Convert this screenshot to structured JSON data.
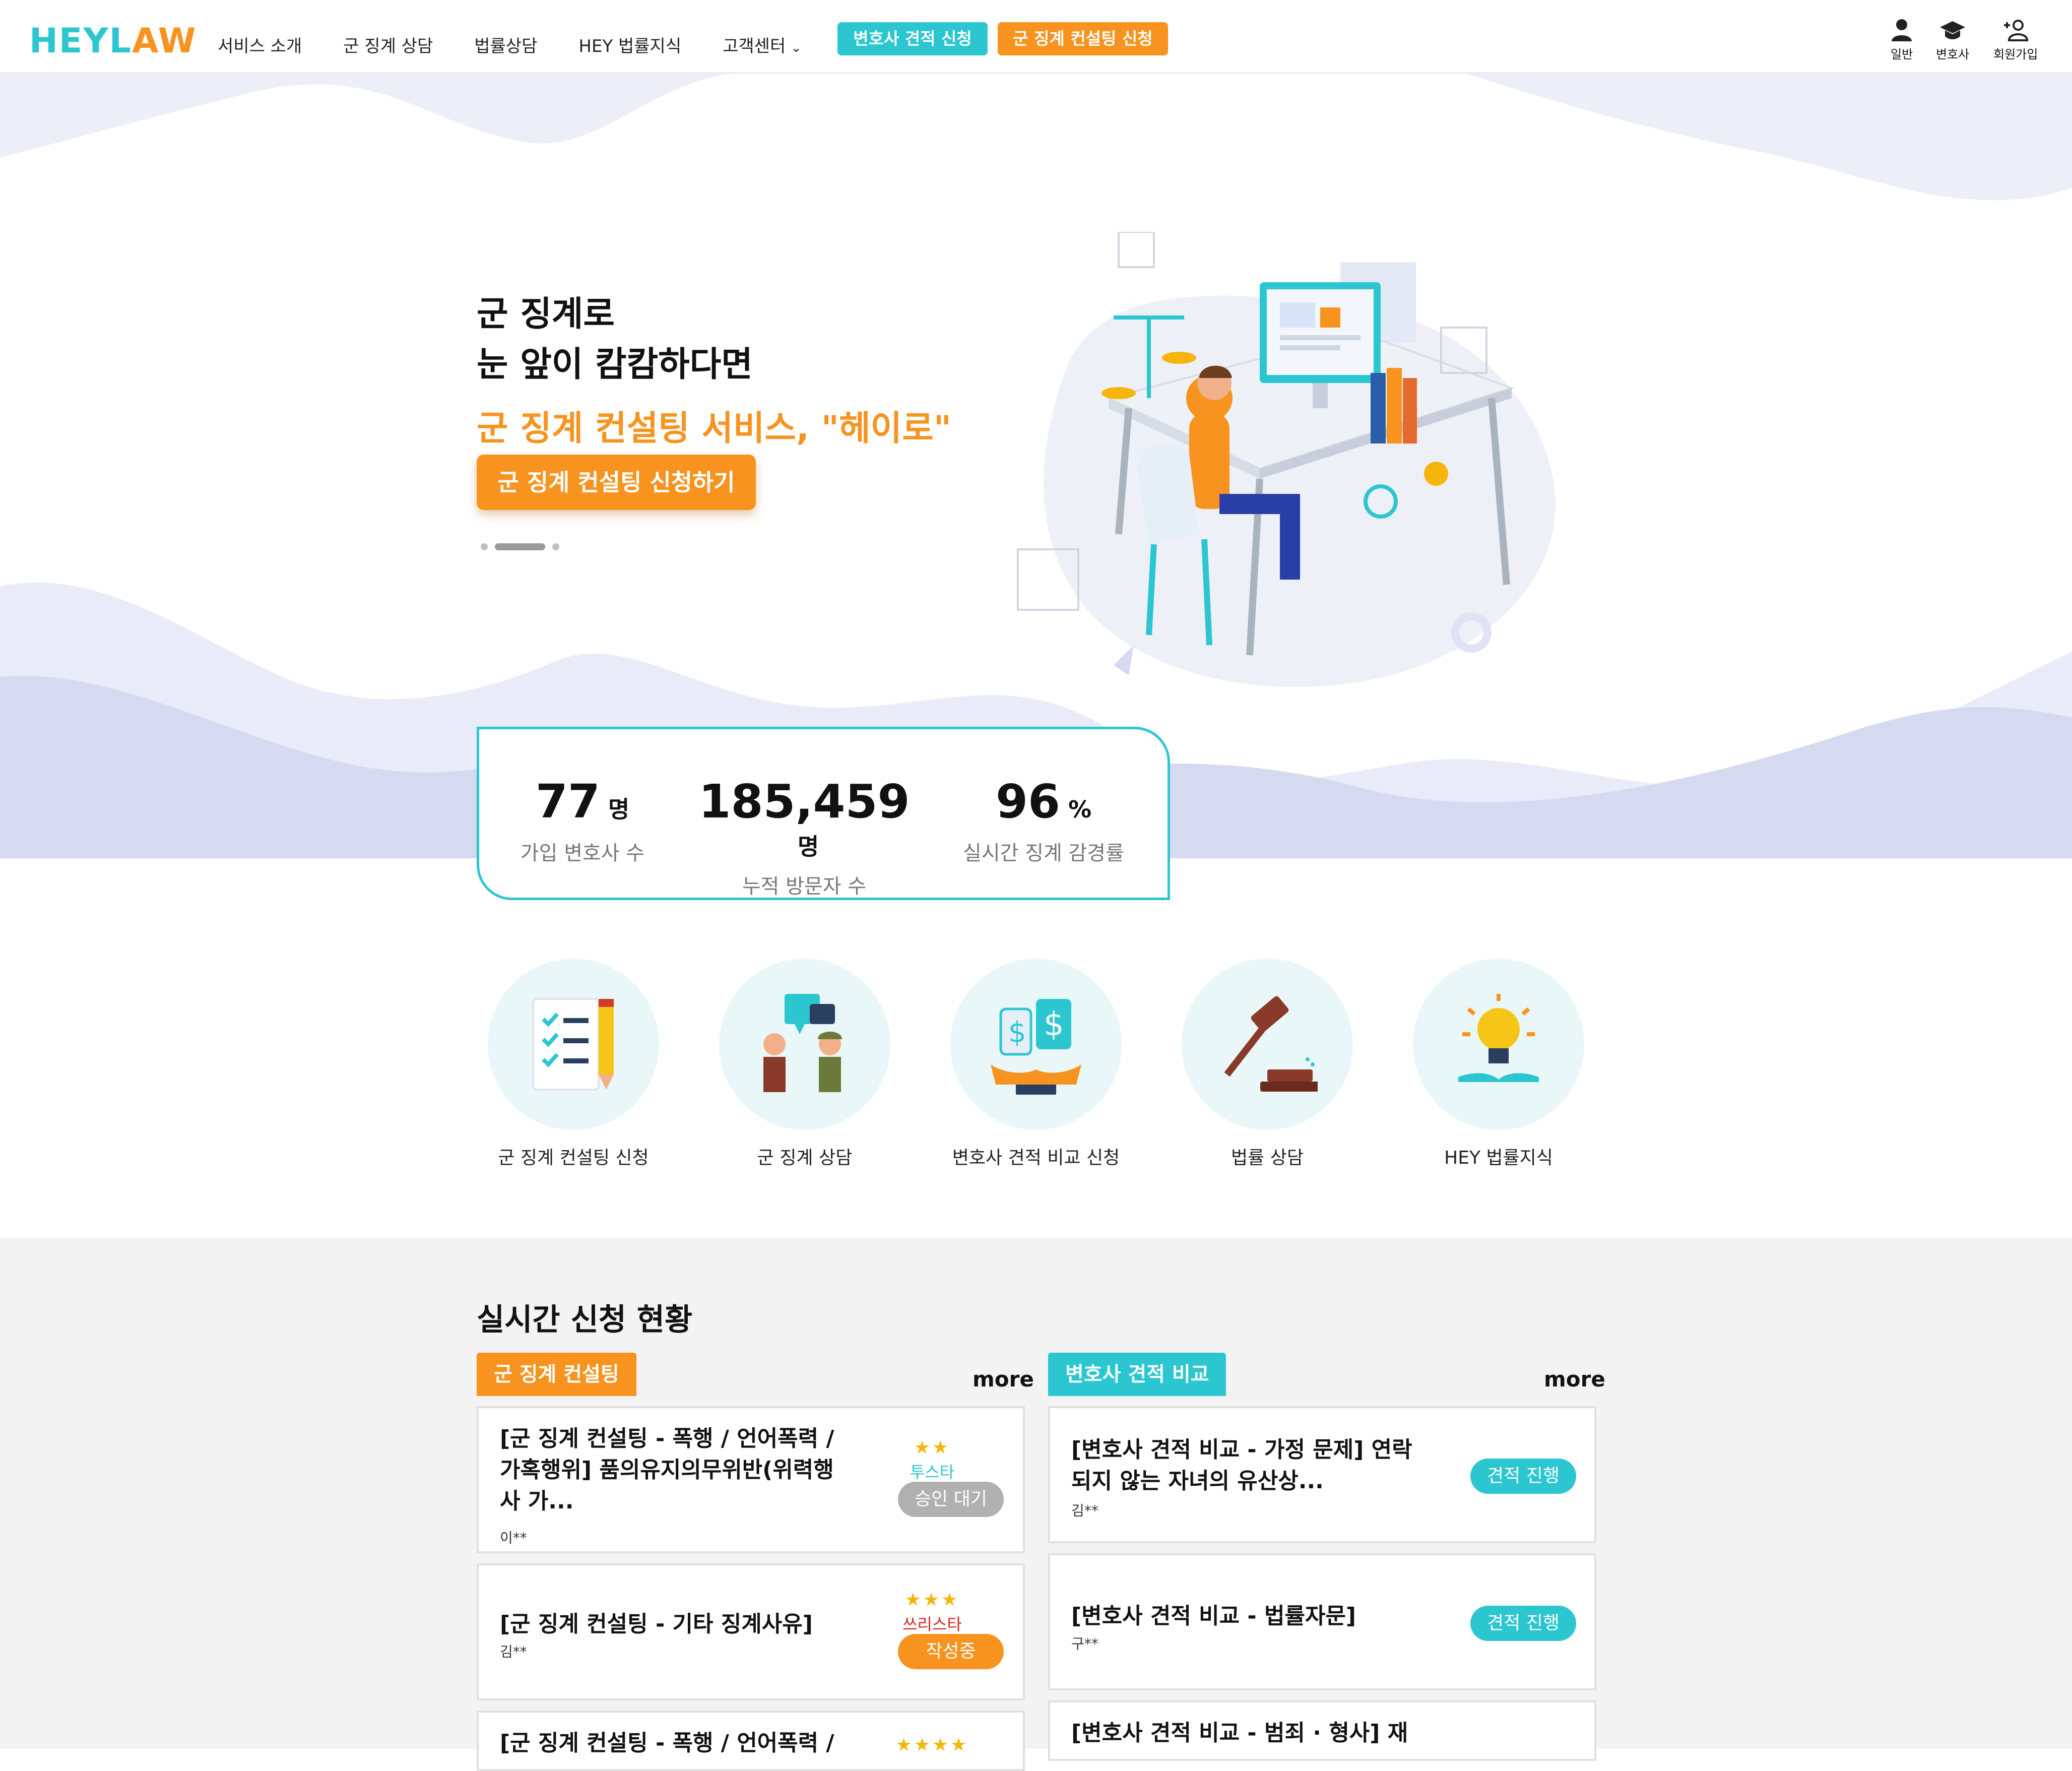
{
  "header": {
    "logo_a": "HEY",
    "logo_b": "L",
    "logo_c": "AW",
    "nav": [
      "서비스 소개",
      "군 징계 상담",
      "법률상담",
      "HEY 법률지식",
      "고객센터"
    ],
    "btn_lawyer_quote": "변호사 견적 신청",
    "btn_consulting": "군 징계 컨설팅 신청",
    "user_links": [
      "일반",
      "변호사",
      "회원가입"
    ]
  },
  "hero": {
    "title_line1": "군 징계로",
    "title_line2": "눈 앞이 캄캄하다면",
    "subtitle": "군 징계 컨설팅 서비스, \"헤이로\"",
    "cta": "군 징계 컨설팅 신청하기",
    "slides_total": 3,
    "slide_active": 2
  },
  "stats": [
    {
      "value": "77",
      "unit": "명",
      "label": "가입 변호사 수"
    },
    {
      "value": "185,459",
      "unit": "명",
      "label": "누적 방문자 수"
    },
    {
      "value": "96",
      "unit": "%",
      "label": "실시간 징계 감경률"
    }
  ],
  "services": [
    {
      "label": "군 징계 컨설팅 신청",
      "icon": "checklist-icon"
    },
    {
      "label": "군 징계 상담",
      "icon": "consultation-icon"
    },
    {
      "label": "변호사 견적 비교 신청",
      "icon": "price-tag-icon"
    },
    {
      "label": "법률 상담",
      "icon": "gavel-icon"
    },
    {
      "label": "HEY 법률지식",
      "icon": "lightbulb-icon"
    }
  ],
  "live": {
    "title": "실시간 신청 현황",
    "left_tag": "군 징계 컨설팅",
    "right_tag": "변호사 견적 비교",
    "more": "more",
    "left_cards": [
      {
        "title1": "[군 징계 컨설팅 - 폭행 / 언어폭력 /",
        "title2": "가혹행위] 품의유지의무위반(위력행",
        "title3": "사 가...",
        "name": "이**",
        "stars": "★★",
        "grade": "투스타",
        "status": "승인 대기"
      },
      {
        "title1": "[군 징계 컨설팅 - 기타 징계사유]",
        "name": "김**",
        "stars": "★★★",
        "grade": "쓰리스타",
        "status": "작성중"
      },
      {
        "title1": "[군 징계 컨설팅 - 폭행 / 언어폭력 /",
        "stars": "★★★★"
      }
    ],
    "right_cards": [
      {
        "title1": "[변호사 견적 비교 - 가정 문제] 연락",
        "title2": "되지 않는 자녀의 유산상...",
        "name": "김**",
        "status": "견적 진행"
      },
      {
        "title1": "[변호사 견적 비교 - 법률자문]",
        "name": "구**",
        "status": "견적 진행"
      },
      {
        "title1": "[변호사 견적 비교 - 범죄 · 형사] 재"
      }
    ]
  },
  "colors": {
    "teal": "#2cc6d1",
    "orange": "#f7931e",
    "wave": "#dfe3f3"
  }
}
